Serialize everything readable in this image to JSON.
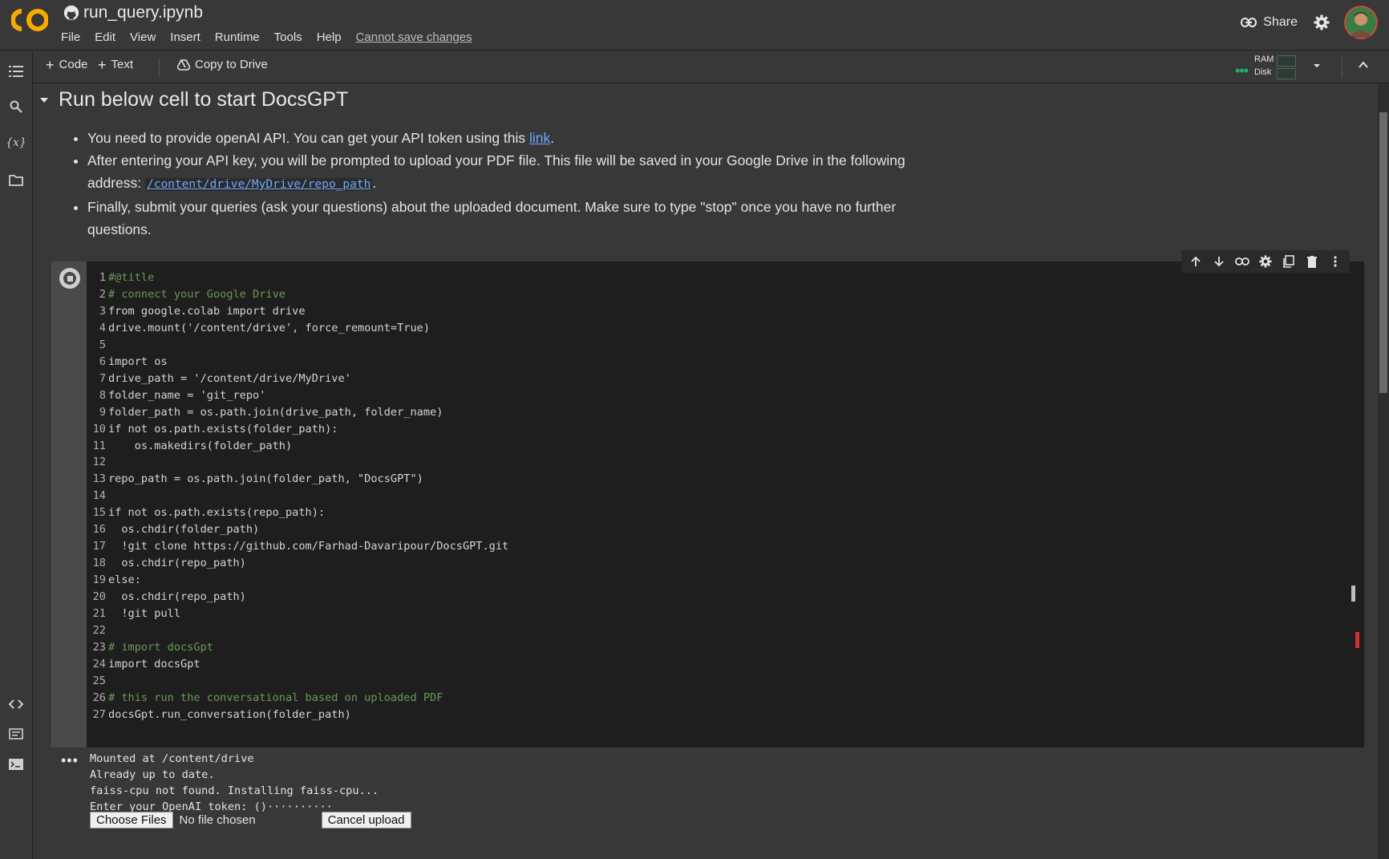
{
  "header": {
    "notebook_title": "run_query.ipynb",
    "menu": [
      "File",
      "Edit",
      "View",
      "Insert",
      "Runtime",
      "Tools",
      "Help"
    ],
    "cannot_save": "Cannot save changes",
    "share_label": "Share"
  },
  "toolbar": {
    "code_label": "Code",
    "text_label": "Text",
    "copy_to_drive_label": "Copy to Drive",
    "ram_label": "RAM",
    "disk_label": "Disk"
  },
  "section": {
    "title": "Run below cell to start DocsGPT",
    "bullet1_text": "You need to provide openAI API. You can get your API token using this ",
    "bullet1_link": "link",
    "bullet1_end": ".",
    "bullet2_text": "After entering your API key, you will be prompted to upload your PDF file. This file will be saved in your Google Drive in the following address: ",
    "bullet2_path": "/content/drive/MyDrive/repo_path",
    "bullet2_end": ".",
    "bullet3_text": "Finally, submit your queries (ask your questions) about the uploaded document. Make sure to type \"stop\" once you have no further questions."
  },
  "code_lines": [
    "#@title",
    "# connect your Google Drive",
    "from google.colab import drive",
    "drive.mount('/content/drive', force_remount=True)",
    "",
    "import os",
    "drive_path = '/content/drive/MyDrive'",
    "folder_name = 'git_repo'",
    "folder_path = os.path.join(drive_path, folder_name)",
    "if not os.path.exists(folder_path):",
    "    os.makedirs(folder_path)",
    "",
    "repo_path = os.path.join(folder_path, \"DocsGPT\")",
    "",
    "if not os.path.exists(repo_path):",
    "  os.chdir(folder_path)",
    "  !git clone https://github.com/Farhad-Davaripour/DocsGPT.git",
    "  os.chdir(repo_path)",
    "else:",
    "  os.chdir(repo_path)",
    "  !git pull",
    "",
    "# import docsGpt",
    "import docsGpt",
    "",
    "# this run the conversational based on uploaded PDF",
    "docsGpt.run_conversation(folder_path)"
  ],
  "output": {
    "lines": "Mounted at /content/drive\nAlready up to date.\nfaiss-cpu not found. Installing faiss-cpu...\nEnter your OpenAI token: ()··········",
    "choose_files": "Choose Files",
    "no_file": "No file chosen",
    "cancel_upload": "Cancel upload"
  },
  "colors": {
    "background": "#383838",
    "code_bg": "#1e1e1e",
    "link": "#6fa7ff",
    "logo_orange": "#f9ab00"
  },
  "icons": [
    "colab-logo",
    "github-icon",
    "link-icon",
    "gear-icon",
    "avatar",
    "plus-icon",
    "drive-icon",
    "chevron-down-icon",
    "chevron-up-icon",
    "toc-icon",
    "search-icon",
    "variables-icon",
    "folder-icon",
    "code-snippets-icon",
    "command-palette-icon",
    "terminal-icon",
    "arrow-up-icon",
    "arrow-down-icon",
    "link-icon",
    "settings-icon",
    "mirror-icon",
    "delete-icon",
    "more-vert-icon",
    "run-stop-icon"
  ]
}
